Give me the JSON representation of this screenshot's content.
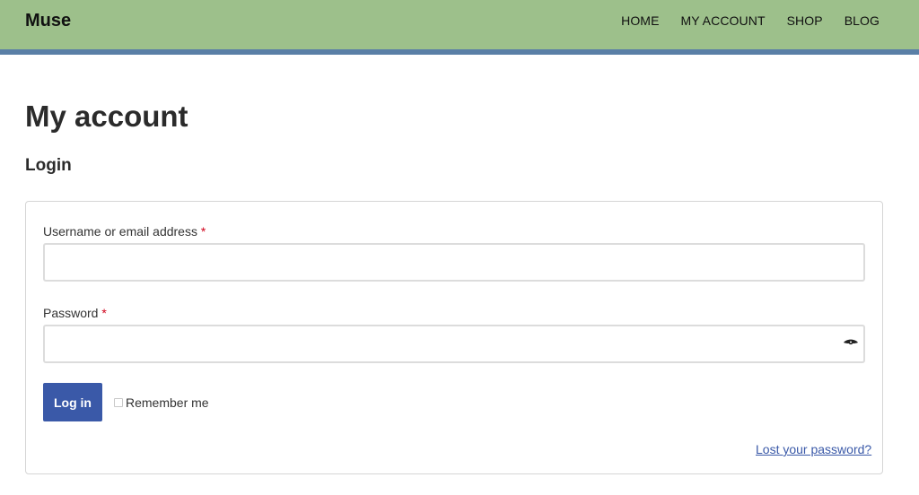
{
  "header": {
    "site_title": "Muse",
    "nav": [
      {
        "label": "HOME"
      },
      {
        "label": "MY ACCOUNT"
      },
      {
        "label": "SHOP"
      },
      {
        "label": "BLOG"
      }
    ]
  },
  "page": {
    "title": "My account",
    "section_title": "Login"
  },
  "login_form": {
    "username_label": "Username or email address",
    "username_value": "",
    "password_label": "Password",
    "password_value": "",
    "required_marker": "*",
    "password_toggle_icon": "eye-icon",
    "submit_label": "Log in",
    "remember_label": "Remember me",
    "remember_checked": false,
    "lost_password_label": "Lost your password?"
  },
  "colors": {
    "header_bg": "#9dc08b",
    "header_stripe": "#5a7fa6",
    "button_bg": "#3a59a8",
    "required": "#d0021b"
  }
}
